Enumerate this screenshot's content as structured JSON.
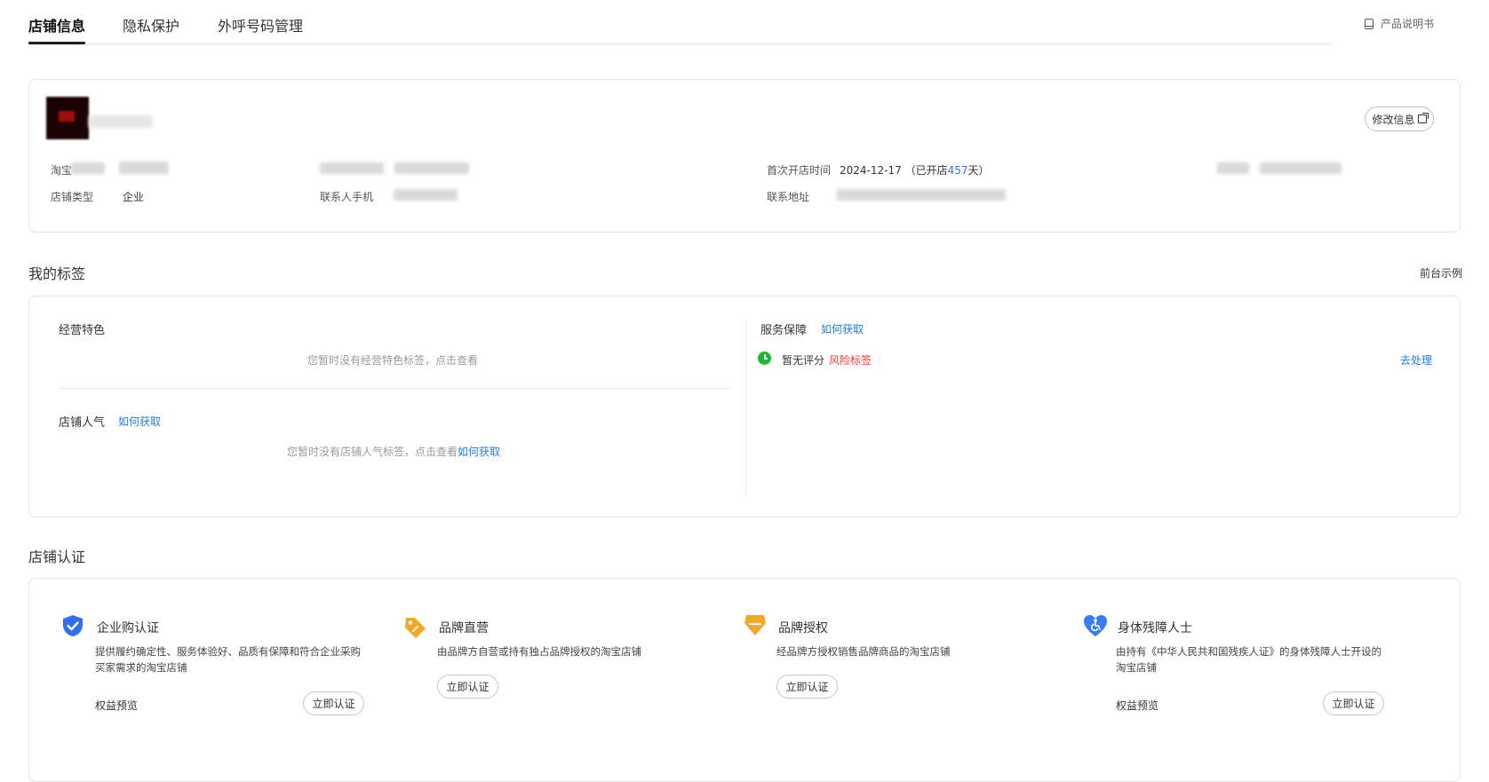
{
  "tabs": [
    {
      "label": "店铺信息",
      "active": true
    },
    {
      "label": "隐私保护",
      "active": false
    },
    {
      "label": "外呼号码管理",
      "active": false
    }
  ],
  "manual_label": "产品说明书",
  "shop_info": {
    "edit_label": "修改信息",
    "fields": {
      "taobao_label_partial": "淘宝",
      "shop_type_label": "店铺类型",
      "shop_type_value": "企业",
      "contact_phone_label": "联系人手机",
      "first_open_label": "首次开店时间",
      "first_open_date": "2024-12-17",
      "open_days_prefix": "（已开店",
      "open_days": "457",
      "open_days_suffix": "天）",
      "address_label": "联系地址"
    }
  },
  "tags_section": {
    "title": "我的标签",
    "front_example": "前台示例",
    "business_feature": {
      "title": "经营特色",
      "empty_text": "您暂时没有经营特色标签，点击查看"
    },
    "popularity": {
      "title": "店铺人气",
      "how_link": "如何获取",
      "empty_text": "您暂时没有店铺人气标签，点击查看",
      "empty_link": "如何获取"
    },
    "service": {
      "title": "服务保障",
      "how_link": "如何获取",
      "no_rating": "暂无评分",
      "risk_tag": "风险标签",
      "action": "去处理"
    }
  },
  "cert_section": {
    "title": "店铺认证",
    "items": [
      {
        "title": "企业购认证",
        "desc": "提供履约确定性、服务体验好、品质有保障和符合企业采购买家需求的淘宝店铺",
        "rights": "权益预览",
        "button": "立即认证",
        "icon": "shield-check-icon",
        "color": "#2f6ff0"
      },
      {
        "title": "品牌直营",
        "desc": "由品牌方自营或持有独占品牌授权的淘宝店铺",
        "button": "立即认证",
        "icon": "tag-icon",
        "color": "#f5a623"
      },
      {
        "title": "品牌授权",
        "desc": "经品牌方授权销售品牌商品的淘宝店铺",
        "button": "立即认证",
        "icon": "diamond-icon",
        "color": "#f5a623"
      },
      {
        "title": "身体残障人士",
        "desc": "由持有《中华人民共和国残疾人证》的身体残障人士开设的淘宝店铺",
        "rights": "权益预览",
        "button": "立即认证",
        "icon": "accessibility-heart-icon",
        "color": "#3a7bf3"
      }
    ]
  }
}
